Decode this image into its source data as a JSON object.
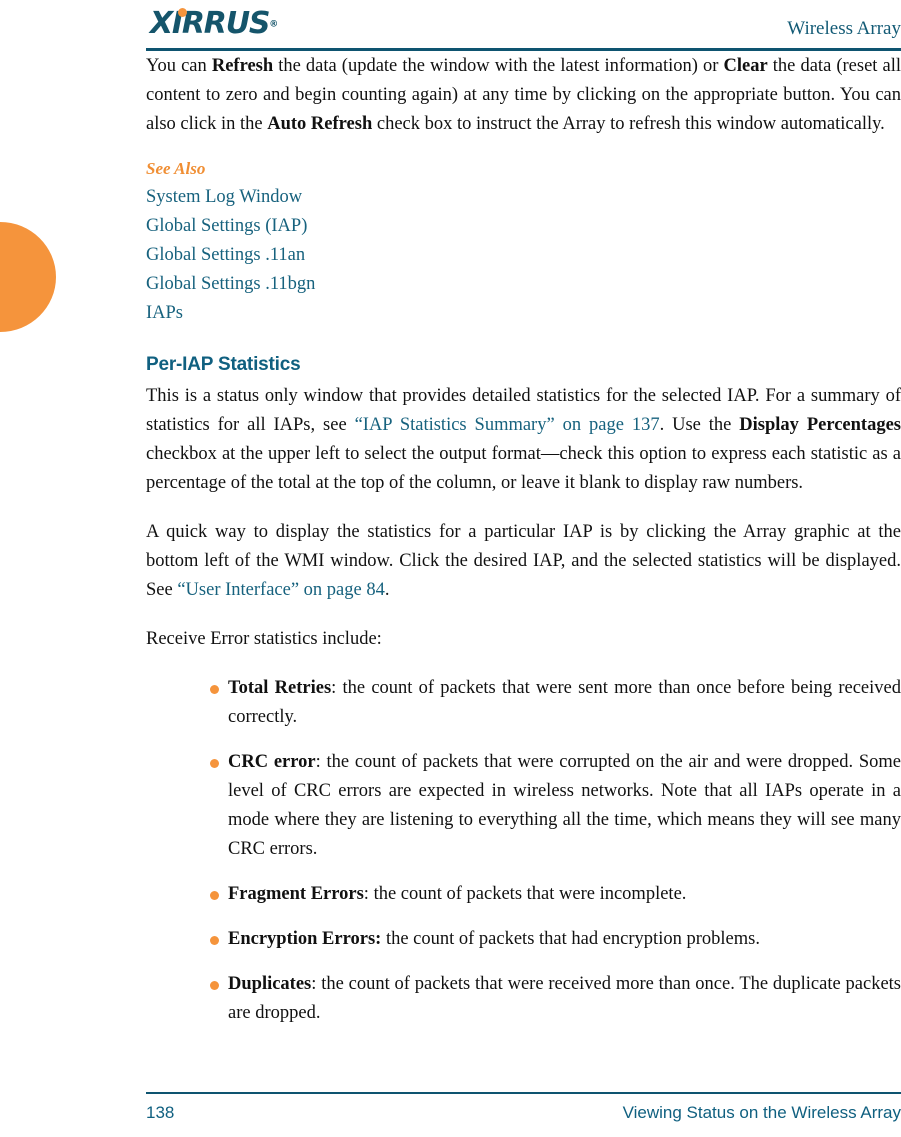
{
  "header": {
    "logo_text": "XIRRUS",
    "logo_registered": "®",
    "title": "Wireless Array"
  },
  "body": {
    "para_refresh": {
      "t1": "You can ",
      "b1": "Refresh",
      "t2": " the data (update the window with the latest information) or ",
      "b2": "Clear",
      "t3": " the data (reset all content to zero and begin counting again) at any time by clicking on the appropriate button. You can also click in the ",
      "b3": "Auto Refresh",
      "t4": " check box to instruct the Array to refresh this window automatically."
    },
    "see_also": {
      "heading": "See Also",
      "links": [
        "System Log Window",
        "Global Settings (IAP)",
        "Global Settings .11an",
        "Global Settings .11bgn",
        "IAPs"
      ]
    },
    "section_heading": "Per-IAP Statistics",
    "para_periap": {
      "t1": "This is a status only window that provides detailed statistics for the selected IAP. For a summary of statistics for all IAPs, see ",
      "link1": "“IAP Statistics Summary” on page 137",
      "t2": ". Use the ",
      "b1": "Display Percentages",
      "t3": " checkbox at the upper left to select the output format—check this option to express each statistic as a percentage of the total at the top of the column, or leave it blank to display raw numbers."
    },
    "para_quickway": {
      "t1": "A quick way to display the statistics for a particular IAP is by clicking the Array graphic at the bottom left of the WMI window. Click the desired IAP, and the selected statistics will be displayed. See ",
      "link1": "“User Interface” on page 84",
      "t2": "."
    },
    "para_receive_error": "Receive Error statistics include:",
    "bullets": [
      {
        "term": "Total Retries",
        "term_punct": ":",
        "text": " the count of packets that were sent more than once before being received correctly."
      },
      {
        "term": "CRC error",
        "term_punct": ":",
        "text": " the count of packets that were corrupted on the air and were dropped. Some level of CRC errors are expected in wireless networks. Note that all IAPs operate in a mode where they are listening to everything all the time, which means they will see many CRC errors."
      },
      {
        "term": "Fragment Errors",
        "term_punct": ":",
        "text": " the count of packets that were incomplete."
      },
      {
        "term": "Encryption Errors:",
        "term_punct": "",
        "text": " the count of packets that had encryption problems."
      },
      {
        "term": "Duplicates",
        "term_punct": ":",
        "text": " the count of packets that were received more than once. The duplicate packets are dropped."
      }
    ]
  },
  "footer": {
    "page_number": "138",
    "chapter_title": "Viewing Status on the Wireless Array"
  },
  "colors": {
    "teal": "#106080",
    "orange": "#F5943C",
    "link_teal": "#17627E"
  }
}
